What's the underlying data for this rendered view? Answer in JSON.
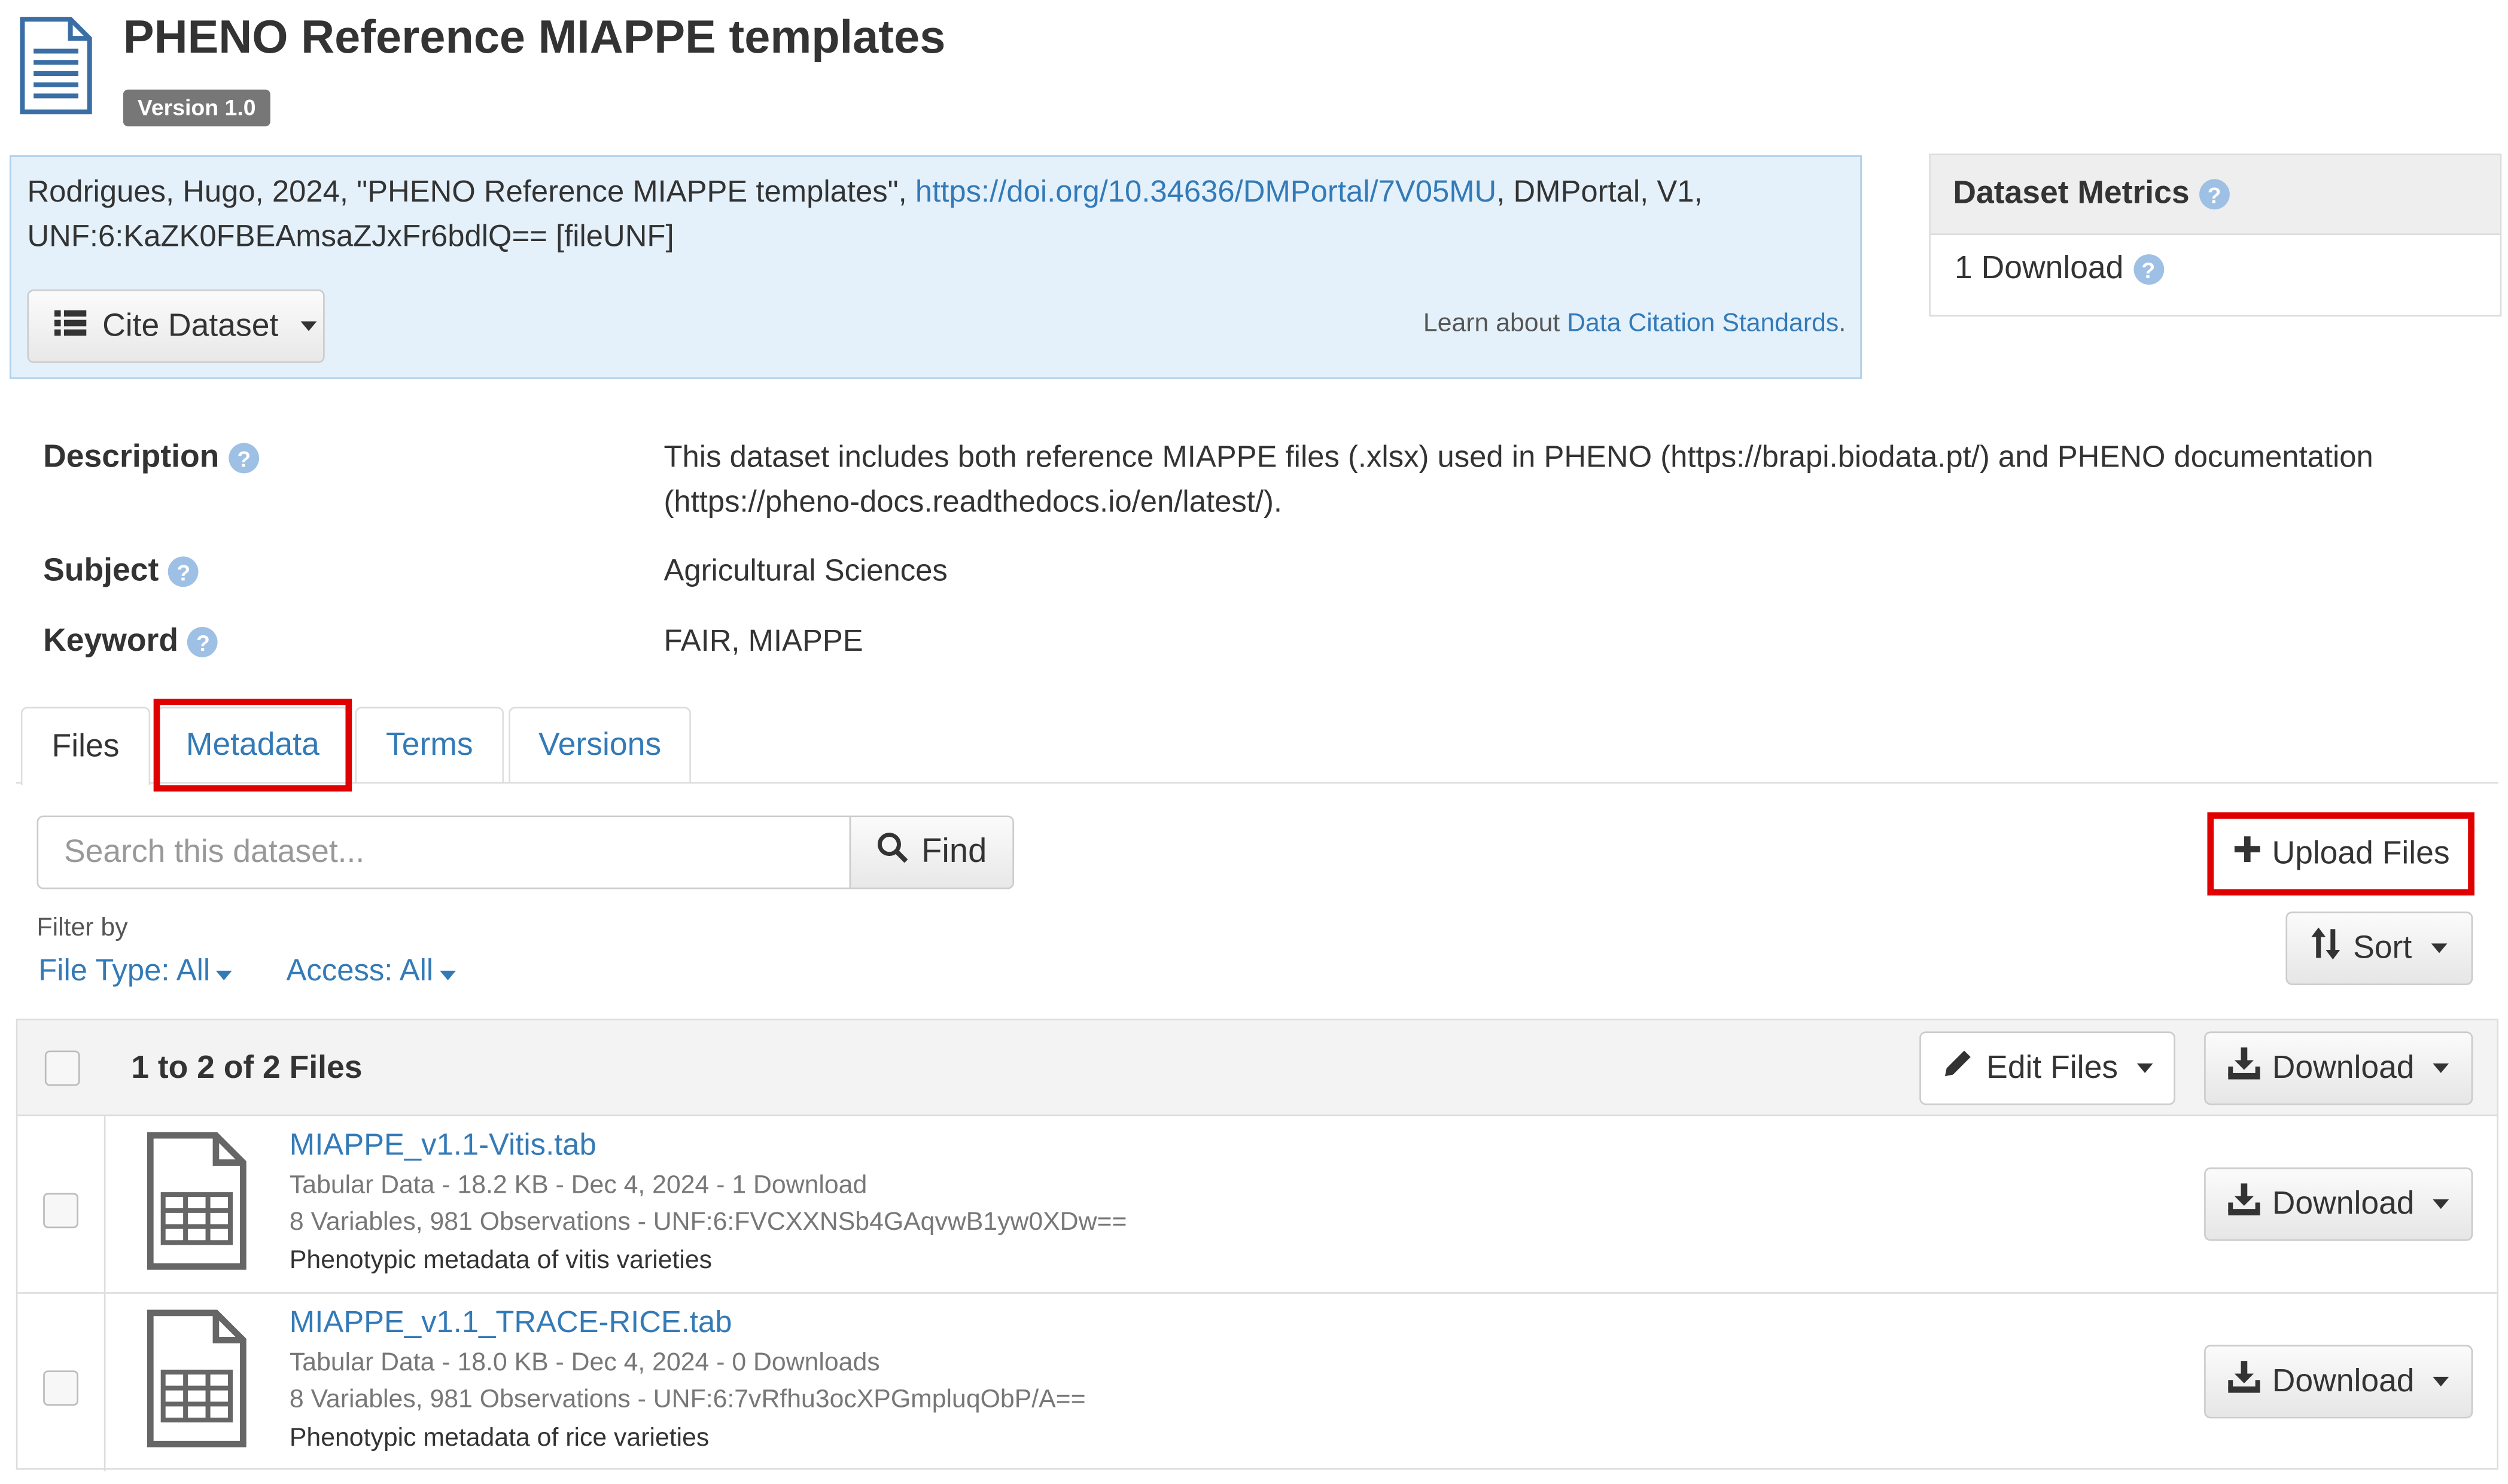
{
  "header": {
    "title": "PHENO Reference MIAPPE templates",
    "version": "Version 1.0",
    "icon": "document-icon"
  },
  "citation": {
    "text_before": "Rodrigues, Hugo, 2024, \"PHENO Reference MIAPPE templates\", ",
    "doi_link": "https://doi.org/10.34636/DMPortal/7V05MU",
    "text_after": ", DMPortal, V1,",
    "unf_line": "UNF:6:KaZK0FBEAmsaZJxFr6bdlQ== [fileUNF]",
    "cite_button": "Cite Dataset",
    "learn_prefix": "Learn about ",
    "learn_link": "Data Citation Standards",
    "learn_suffix": "."
  },
  "metrics": {
    "title": "Dataset Metrics",
    "downloads": "1 Download"
  },
  "metadata": {
    "description_label": "Description",
    "description_value": "This dataset includes both reference MIAPPE files (.xlsx) used in PHENO (https://brapi.biodata.pt/) and PHENO documentation (https://pheno-docs.readthedocs.io/en/latest/).",
    "subject_label": "Subject",
    "subject_value": "Agricultural Sciences",
    "keyword_label": "Keyword",
    "keyword_value": "FAIR, MIAPPE"
  },
  "tabs": [
    {
      "label": "Files",
      "active": true
    },
    {
      "label": "Metadata",
      "active": false,
      "highlighted": true
    },
    {
      "label": "Terms",
      "active": false
    },
    {
      "label": "Versions",
      "active": false
    }
  ],
  "search": {
    "placeholder": "Search this dataset...",
    "find_label": "Find"
  },
  "upload_label": "Upload Files",
  "filter": {
    "label": "Filter by",
    "file_type": "File Type: All",
    "access": "Access: All"
  },
  "sort_label": "Sort",
  "files_table": {
    "count_label": "1 to 2 of 2 Files",
    "edit_files_label": "Edit Files",
    "download_label": "Download",
    "rows": [
      {
        "name": "MIAPPE_v1.1-Vitis.tab",
        "meta": "Tabular Data - 18.2 KB - Dec 4, 2024 - 1 Download",
        "vars": "8 Variables, 981 Observations - UNF:6:FVCXXNSb4GAqvwB1yw0XDw==",
        "desc": "Phenotypic metadata of vitis varieties",
        "download_label": "Download"
      },
      {
        "name": "MIAPPE_v1.1_TRACE-RICE.tab",
        "meta": "Tabular Data - 18.0 KB - Dec 4, 2024 - 0 Downloads",
        "vars": "8 Variables, 981 Observations - UNF:6:7vRfhu3ocXPGmpluqObP/A==",
        "desc": "Phenotypic metadata of rice varieties",
        "download_label": "Download"
      }
    ]
  },
  "colors": {
    "link": "#337ab7",
    "highlight": "#e00000",
    "citation_bg": "#e4f1fb",
    "version_badge": "#777777"
  }
}
